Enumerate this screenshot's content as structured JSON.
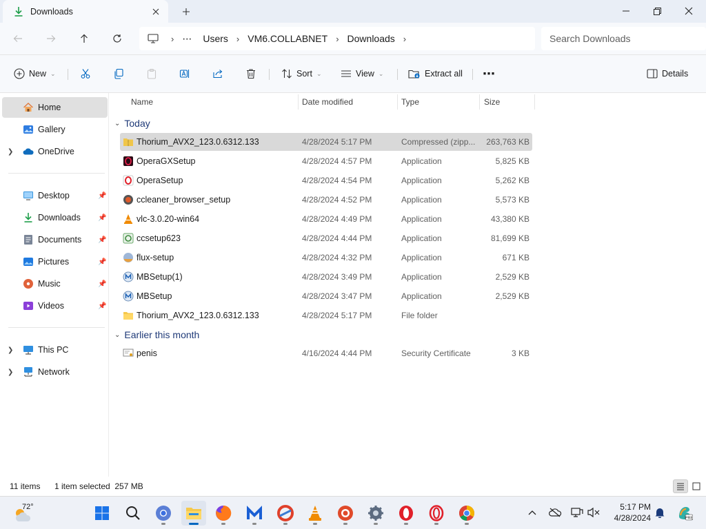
{
  "window": {
    "tab_title": "Downloads"
  },
  "address": {
    "crumbs": [
      "Users",
      "VM6.COLLABNET",
      "Downloads"
    ],
    "overflow": "⋯",
    "search_placeholder": "Search Downloads"
  },
  "commands": {
    "new": "New",
    "sort": "Sort",
    "view": "View",
    "extract_all": "Extract all",
    "more": "⋯",
    "details": "Details"
  },
  "sidebar": {
    "items": [
      {
        "label": "Home",
        "icon": "home-icon",
        "selected": true
      },
      {
        "label": "Gallery",
        "icon": "gallery-icon"
      },
      {
        "label": "OneDrive",
        "icon": "onedrive-icon",
        "expandable": true
      },
      {
        "label": "Desktop",
        "icon": "desktop-icon",
        "pinned": true
      },
      {
        "label": "Downloads",
        "icon": "downloads-icon",
        "pinned": true
      },
      {
        "label": "Documents",
        "icon": "documents-icon",
        "pinned": true
      },
      {
        "label": "Pictures",
        "icon": "pictures-icon",
        "pinned": true
      },
      {
        "label": "Music",
        "icon": "music-icon",
        "pinned": true
      },
      {
        "label": "Videos",
        "icon": "videos-icon",
        "pinned": true
      },
      {
        "label": "This PC",
        "icon": "this-pc-icon",
        "expandable": true
      },
      {
        "label": "Network",
        "icon": "network-icon",
        "expandable": true
      }
    ]
  },
  "columns": {
    "name": "Name",
    "date": "Date modified",
    "type": "Type",
    "size": "Size"
  },
  "groups": [
    {
      "title": "Today",
      "files": [
        {
          "name": "Thorium_AVX2_123.0.6312.133",
          "date": "4/28/2024 5:17 PM",
          "type": "Compressed (zipp...",
          "size": "263,763 KB",
          "icon": "zip-folder-icon",
          "selected": true
        },
        {
          "name": "OperaGXSetup",
          "date": "4/28/2024 4:57 PM",
          "type": "Application",
          "size": "5,825 KB",
          "icon": "opera-gx-icon"
        },
        {
          "name": "OperaSetup",
          "date": "4/28/2024 4:54 PM",
          "type": "Application",
          "size": "5,262 KB",
          "icon": "opera-setup-icon"
        },
        {
          "name": "ccleaner_browser_setup",
          "date": "4/28/2024 4:52 PM",
          "type": "Application",
          "size": "5,573 KB",
          "icon": "ccleaner-browser-icon"
        },
        {
          "name": "vlc-3.0.20-win64",
          "date": "4/28/2024 4:49 PM",
          "type": "Application",
          "size": "43,380 KB",
          "icon": "vlc-icon"
        },
        {
          "name": "ccsetup623",
          "date": "4/28/2024 4:44 PM",
          "type": "Application",
          "size": "81,699 KB",
          "icon": "ccleaner-icon"
        },
        {
          "name": "flux-setup",
          "date": "4/28/2024 4:32 PM",
          "type": "Application",
          "size": "671 KB",
          "icon": "flux-icon"
        },
        {
          "name": "MBSetup(1)",
          "date": "4/28/2024 3:49 PM",
          "type": "Application",
          "size": "2,529 KB",
          "icon": "malwarebytes-icon"
        },
        {
          "name": "MBSetup",
          "date": "4/28/2024 3:47 PM",
          "type": "Application",
          "size": "2,529 KB",
          "icon": "malwarebytes-icon"
        },
        {
          "name": "Thorium_AVX2_123.0.6312.133",
          "date": "4/28/2024 5:17 PM",
          "type": "File folder",
          "size": "",
          "icon": "folder-icon"
        }
      ]
    },
    {
      "title": "Earlier this month",
      "files": [
        {
          "name": "penis",
          "date": "4/16/2024 4:44 PM",
          "type": "Security Certificate",
          "size": "3 KB",
          "icon": "certificate-icon"
        }
      ]
    }
  ],
  "status": {
    "items_count": "11 items",
    "selection": "1 item selected  257 MB"
  },
  "taskbar": {
    "weather_temp": "72°",
    "clock_time": "5:17 PM",
    "clock_date": "4/28/2024"
  },
  "colors": {
    "accent": "#0067c0",
    "selected_row": "#d9d9d9",
    "group_title": "#1f3a78"
  }
}
